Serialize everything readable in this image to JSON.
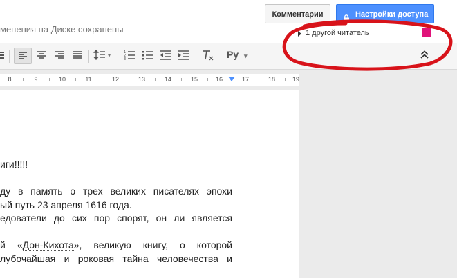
{
  "header": {
    "saved_status": "менения на Диске сохранены",
    "comments_button": "Комментарии",
    "share_button": "Настройки доступа",
    "share_icon": "lock-icon"
  },
  "viewers": {
    "label": "1 другой читатель",
    "swatch_color": "#e0137a"
  },
  "toolbar": {
    "language_button": "Ру",
    "language_caret": "▾",
    "line_spacing_caret": "▾",
    "icons": [
      "align-left-icon",
      "align-center-icon",
      "align-right-icon",
      "align-justify-icon",
      "line-spacing-icon",
      "numbered-list-icon",
      "bulleted-list-icon",
      "decrease-indent-icon",
      "increase-indent-icon",
      "clear-formatting-icon",
      "collapse-toolbar-icon"
    ]
  },
  "ruler": {
    "numbers": [
      "8",
      "9",
      "10",
      "11",
      "12",
      "13",
      "14",
      "15",
      "16",
      "17",
      "18",
      "19"
    ]
  },
  "document": {
    "heading": "иги!!!!!",
    "p1_line1": "ду в память о трех великих писателях эпохи",
    "p1_line2": "ый путь 23 апреля 1616 года.",
    "p2_line1": "едователи до сих пор спорят, он ли является",
    "p3_line1_prefix": "й «",
    "p3_line1_link": "Дон-Кихота",
    "p3_line1_suffix": "», великую книгу, о которой",
    "p3_line2": "лубочайшая и роковая тайна человечества и"
  },
  "annotation": {
    "color": "#d8131a"
  }
}
